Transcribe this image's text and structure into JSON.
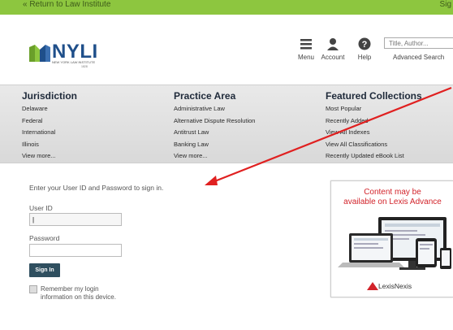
{
  "topbar": {
    "return_label": "« Return to Law Institute",
    "signin_label": "Sig"
  },
  "header": {
    "brand": "NYLI",
    "brand_sub": "NEW YORK LAW INSTITUTE",
    "brand_sub2": "1828",
    "menu_label": "Menu",
    "account_label": "Account",
    "help_label": "Help",
    "search_placeholder": "Title, Author...",
    "advanced_search_label": "Advanced Search"
  },
  "nav": {
    "jurisdiction": {
      "title": "Jurisdiction",
      "items": [
        "Delaware",
        "Federal",
        "International",
        "Illinois",
        "View more..."
      ]
    },
    "practice_area": {
      "title": "Practice Area",
      "items": [
        "Administrative Law",
        "Alternative Dispute Resolution",
        "Antitrust Law",
        "Banking Law",
        "View more..."
      ]
    },
    "featured": {
      "title": "Featured Collections",
      "items": [
        "Most Popular",
        "Recently Added",
        "View All Indexes",
        "View All Classifications",
        "Recently Updated eBook List"
      ]
    }
  },
  "signin": {
    "intro": "Enter your User ID and Password to sign in.",
    "userid_label": "User ID",
    "userid_value": "|",
    "password_label": "Password",
    "password_value": "",
    "button_label": "Sign In",
    "remember_line1": "Remember my login",
    "remember_line2": "information on this device."
  },
  "ad": {
    "headline_line1": "Content may be",
    "headline_line2": "available on Lexis Advance",
    "brand": "LexisNexis"
  },
  "colors": {
    "topbar": "#8dc63f",
    "brand_blue": "#1f4f8a",
    "ad_red": "#d2232a",
    "arrow_red": "#e02020",
    "signin_button": "#2f4f5f"
  }
}
